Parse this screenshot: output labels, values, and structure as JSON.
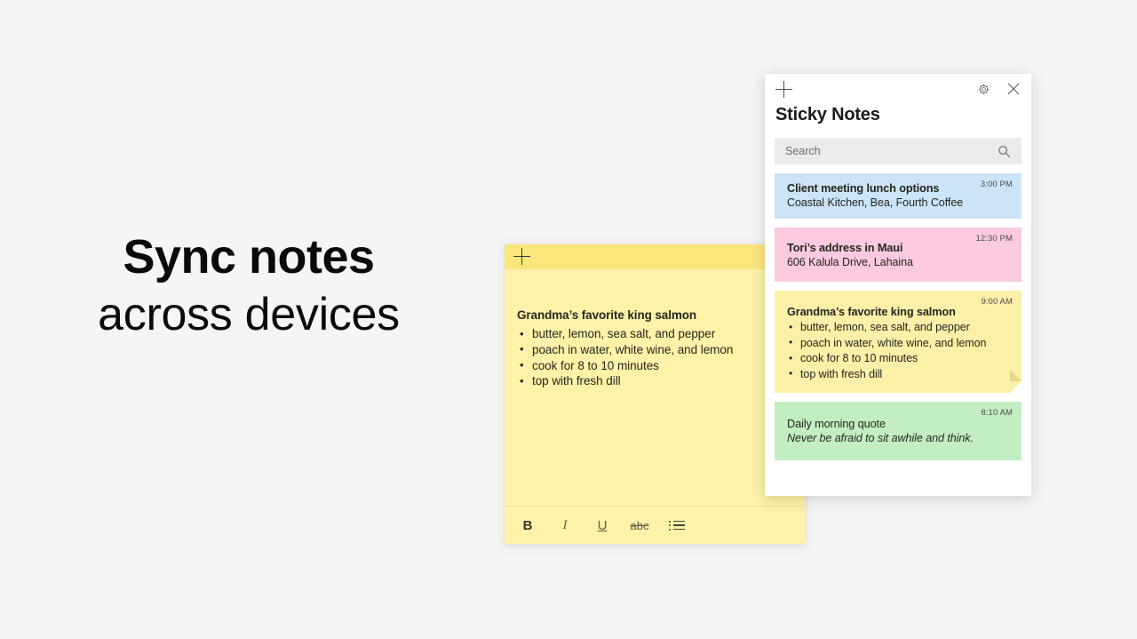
{
  "marketing": {
    "line1": "Sync notes",
    "line2": "across devices"
  },
  "note_window": {
    "add_label": "add-note",
    "menu_label": "•••",
    "title": "Grandma’s favorite king salmon",
    "items": [
      "butter, lemon, sea salt, and pepper",
      "poach in water, white wine, and lemon",
      "cook for 8 to 10 minutes",
      "top with fresh dill"
    ],
    "toolbar": {
      "bold": "B",
      "italic": "I",
      "underline": "U",
      "strikethrough": "abc",
      "bullets": "bullet-list"
    },
    "color": "#fdf2a8",
    "header_color": "#fbe67e"
  },
  "panel": {
    "title": "Sticky Notes",
    "search": {
      "placeholder": "Search",
      "value": ""
    },
    "notes": [
      {
        "title": "Client meeting lunch options",
        "subtitle": "Coastal Kitchen, Bea, Fourth Coffee",
        "time": "3:00 PM",
        "color": "#cce4f7"
      },
      {
        "title": "Tori’s address in Maui",
        "subtitle": "606 Kalula Drive, Lahaina",
        "time": "12:30 PM",
        "color": "#fbc9e0"
      },
      {
        "title": "Grandma’s favorite king salmon",
        "time": "9:00 AM",
        "color": "#fbf0a8",
        "items": [
          "butter, lemon, sea salt, and pepper",
          "poach in water, white wine, and lemon",
          "cook for 8 to 10 minutes",
          "top with fresh dill"
        ]
      },
      {
        "title": "Daily morning quote",
        "subtitle": "Never be afraid to sit awhile and think.",
        "time": "8:10 AM",
        "color": "#c2eec2"
      }
    ]
  }
}
